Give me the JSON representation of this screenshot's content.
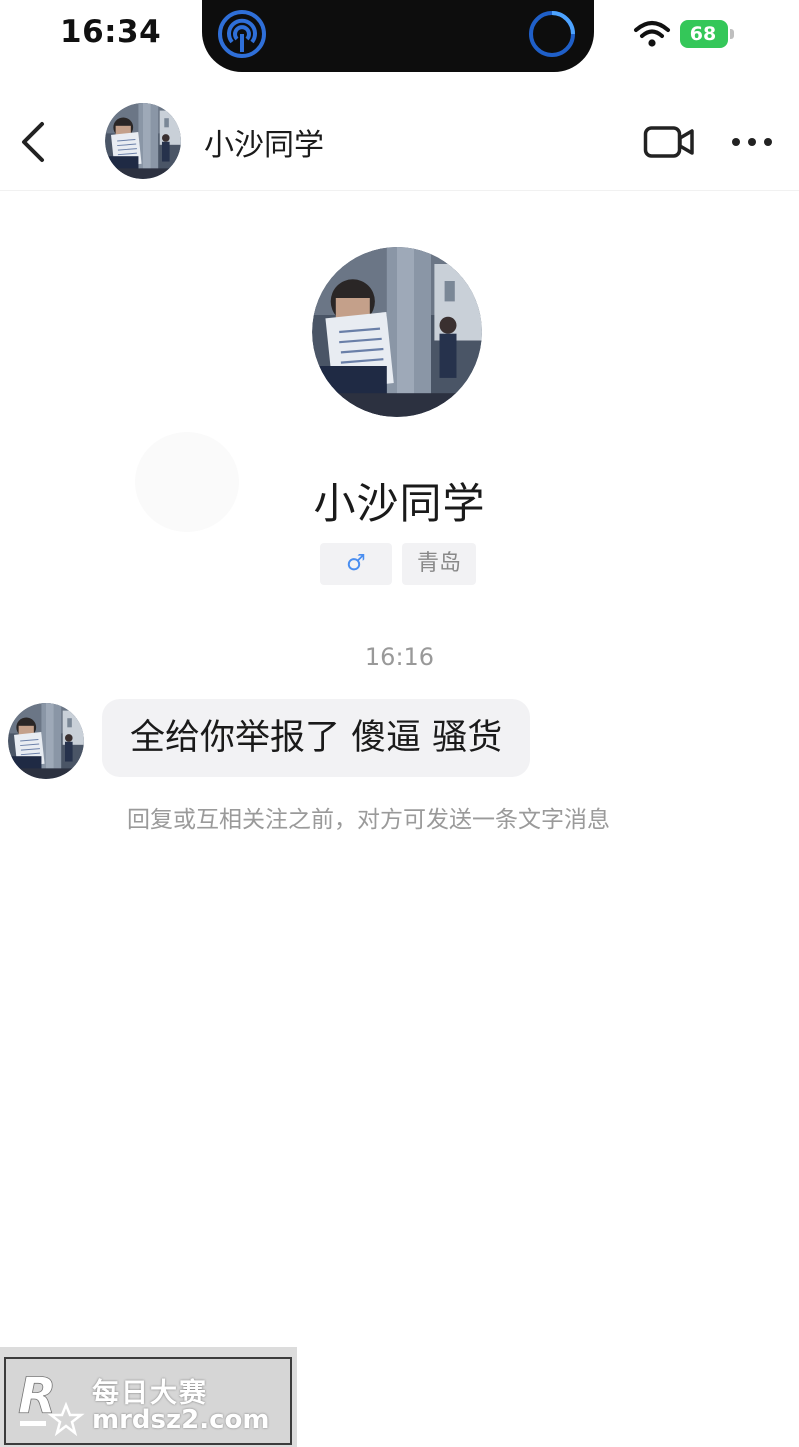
{
  "status_bar": {
    "time": "16:34",
    "battery_level": "68",
    "icons": [
      "airdrop-icon",
      "loading-ring-icon",
      "wifi-icon",
      "battery-icon"
    ]
  },
  "nav": {
    "title": "小沙同学",
    "icons": [
      "back-chevron-icon",
      "video-camera-icon",
      "more-dots-icon"
    ]
  },
  "profile": {
    "name": "小沙同学",
    "gender_symbol": "♂",
    "location": "青岛"
  },
  "chat": {
    "timestamp": "16:16",
    "messages": [
      {
        "text": "全给你举报了 傻逼 骚货"
      }
    ],
    "hint": "回复或互相关注之前，对方可发送一条文字消息"
  },
  "watermark": {
    "line1": "每日大赛",
    "line2": "mrdsz2.com"
  },
  "colors": {
    "accent_blue": "#4a8ef0",
    "battery_green": "#34c759",
    "bubble_bg": "#f2f2f4"
  }
}
